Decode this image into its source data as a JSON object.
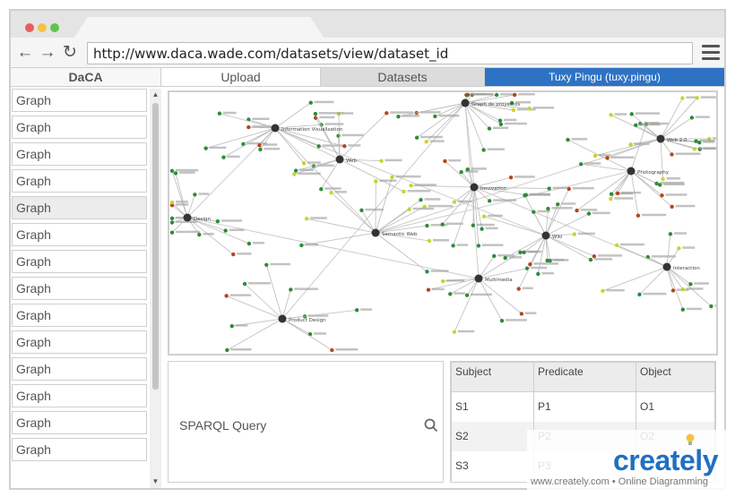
{
  "browser": {
    "url": "http://www.daca.wade.com/datasets/view/dataset_id",
    "dots": [
      "#ee5b5b",
      "#f5c242",
      "#5fc44a"
    ]
  },
  "tabs": {
    "app_name": "DaCA",
    "upload": "Upload",
    "datasets": "Datasets",
    "user": "Tuxy Pingu (tuxy.pingu)",
    "user_bg": "#2e72c4"
  },
  "sidebar": {
    "items": [
      "Graph",
      "Graph",
      "Graph",
      "Graph",
      "Graph",
      "Graph",
      "Graph",
      "Graph",
      "Graph",
      "Graph",
      "Graph",
      "Graph",
      "Graph",
      "Graph"
    ],
    "selected_index": 4
  },
  "graph": {
    "hubs": [
      "Information Visualisation",
      "Web",
      "Design",
      "Semantic Web",
      "Multimedia",
      "Photography",
      "Web 2.0",
      "Graph de proyectos",
      "Innovation",
      "Wiki",
      "Product Design",
      "Interaction"
    ]
  },
  "sparql": {
    "label": "SPARQL Query"
  },
  "results": {
    "headers": [
      "Subject",
      "Predicate",
      "Object"
    ],
    "rows": [
      [
        "S1",
        "P1",
        "O1"
      ],
      [
        "S2",
        "P2",
        "O2"
      ],
      [
        "S3",
        "P3",
        ""
      ]
    ]
  },
  "watermark": {
    "logo": "creately",
    "sub": "www.creately.com • Online Diagramming"
  }
}
